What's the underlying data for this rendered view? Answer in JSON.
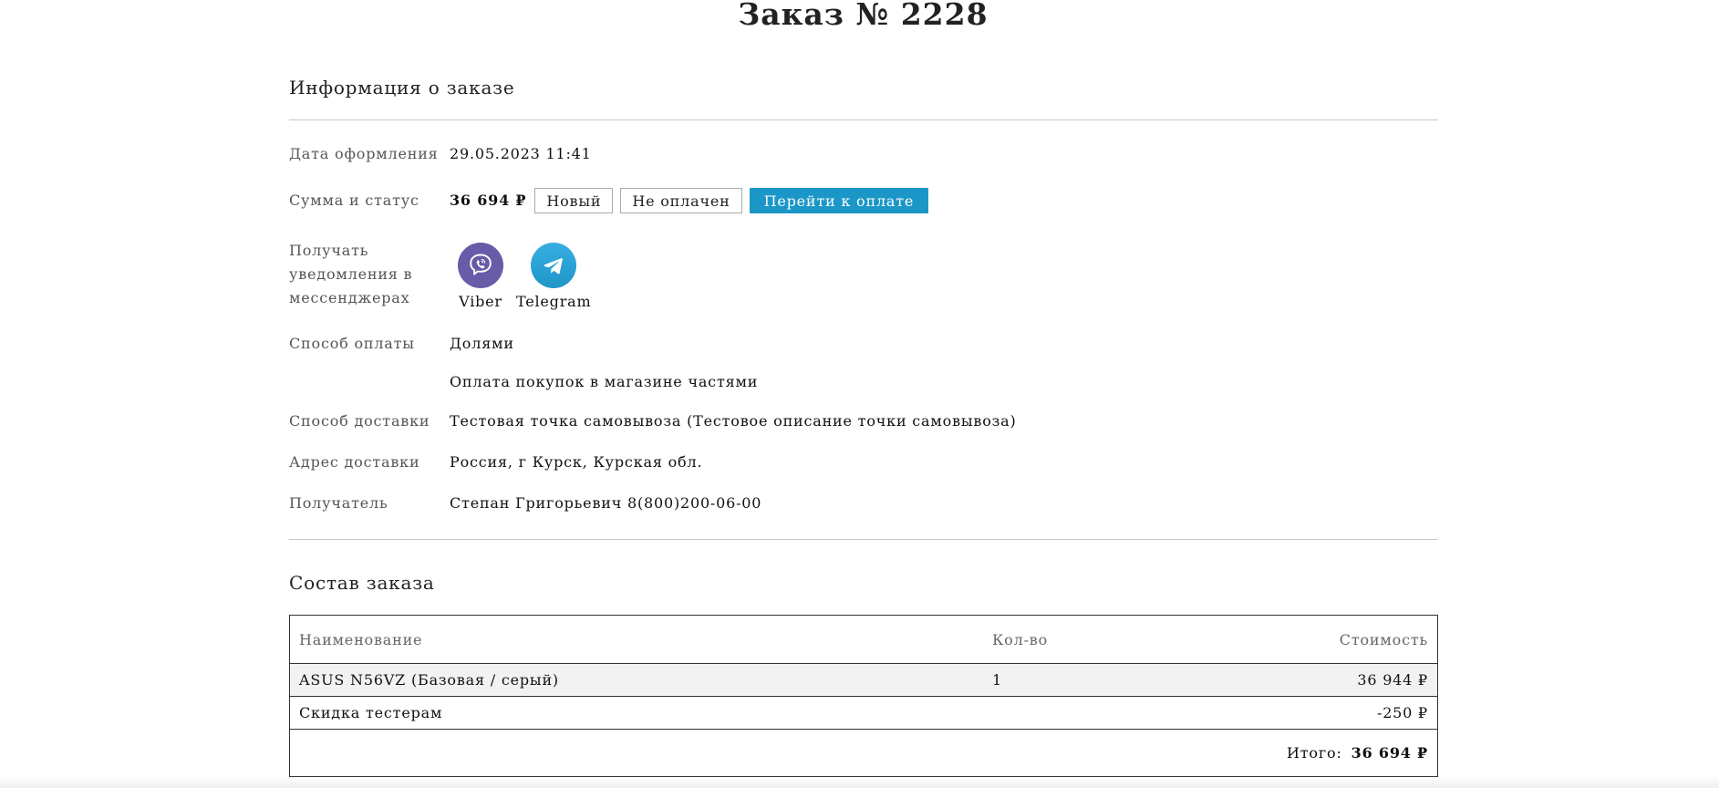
{
  "page": {
    "title": "Заказ № 2228"
  },
  "info_section": {
    "heading": "Информация о заказе",
    "date": {
      "label": "Дата оформления",
      "value": "29.05.2023 11:41"
    },
    "sum_status": {
      "label": "Сумма и статус",
      "amount": "36 694 ₽",
      "status": "Новый",
      "payment_status": "Не оплачен",
      "pay_button": "Перейти к оплате"
    },
    "notifications": {
      "label": "Получать уведомления в мессенджерах",
      "messengers": [
        {
          "name": "Viber",
          "icon": "viber-icon",
          "color": "#665ca7"
        },
        {
          "name": "Telegram",
          "icon": "telegram-icon",
          "color": "#2aa3d9"
        }
      ]
    },
    "payment_method": {
      "label": "Способ оплаты",
      "value": "Долями",
      "description": "Оплата покупок в магазине частями"
    },
    "delivery_method": {
      "label": "Способ доставки",
      "value": "Тестовая точка самовывоза (Тестовое описание точки самовывоза)"
    },
    "delivery_address": {
      "label": "Адрес доставки",
      "value": "Россия, г Курск, Курская обл."
    },
    "recipient": {
      "label": "Получатель",
      "value": "Степан Григорьевич 8(800)200-06-00"
    }
  },
  "composition_section": {
    "heading": "Состав заказа",
    "columns": {
      "name": "Наименование",
      "qty": "Кол-во",
      "price": "Стоимость"
    },
    "rows": [
      {
        "name": "ASUS N56VZ (Базовая / серый)",
        "qty": "1",
        "price": "36 944 ₽"
      },
      {
        "name": "Скидка тестерам",
        "qty": "",
        "price": "-250 ₽"
      }
    ],
    "total_label": "Итого:",
    "total_value": "36 694 ₽"
  },
  "colors": {
    "accent": "#1b97c7",
    "divider": "#c8c8c8"
  }
}
